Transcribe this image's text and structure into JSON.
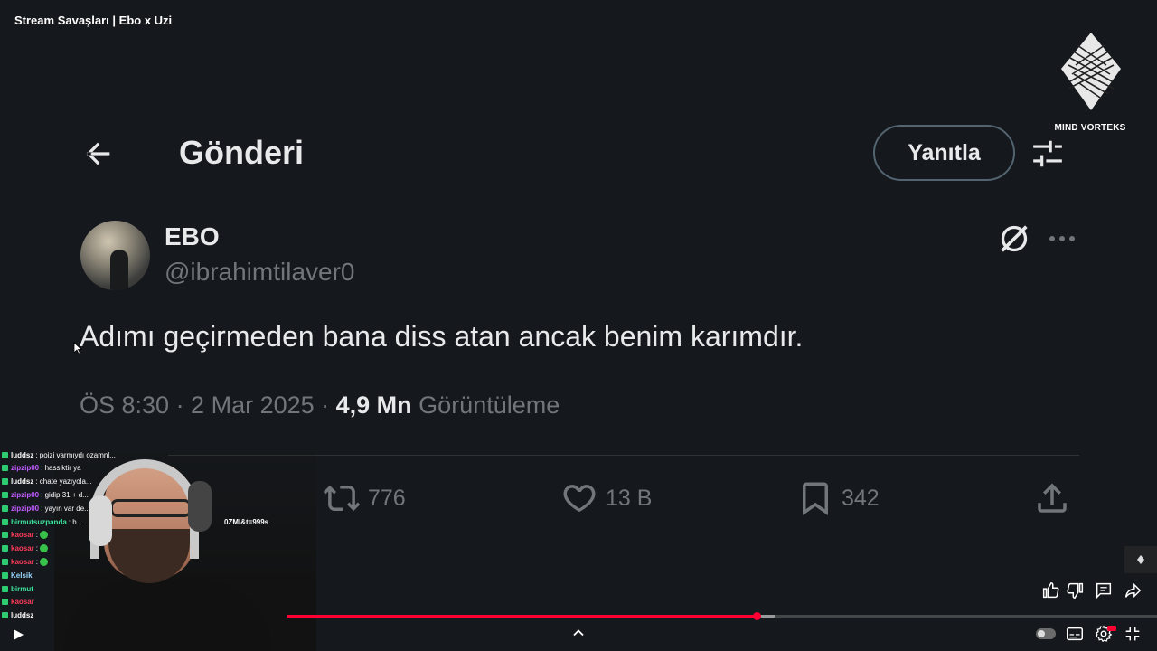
{
  "video": {
    "title": "Stream Savaşları | Ebo x Uzi",
    "channel_logo_text": "MIND VORTEKS",
    "progress_fraction": 0.54,
    "buffer_fraction": 0.56
  },
  "post_header": {
    "title": "Gönderi",
    "reply_label": "Yanıtla"
  },
  "post": {
    "author_name": "EBO",
    "author_handle": "@ibrahimtilaver0",
    "text": "Adımı geçirmeden bana diss atan ancak benim karımdır.",
    "time_date": "ÖS 8:30 · 2 Mar 2025 · ",
    "views_count": "4,9 Mn",
    "views_label": " Görüntüleme"
  },
  "actions": {
    "retweets": "776",
    "likes": "13 B",
    "bookmarks": "342"
  },
  "chat": [
    {
      "user": "luddsz",
      "msg": ": poizi varmıydı ozamnl...",
      "color": "#ffffff",
      "emote": false
    },
    {
      "user": "zipzip00",
      "msg": ": hassiktir ya",
      "color": "#c15cff",
      "emote": false
    },
    {
      "user": "luddsz",
      "msg": ": chate yazıyola...",
      "color": "#ffffff",
      "emote": false
    },
    {
      "user": "zipzip00",
      "msg": ": gidip 31 + d...",
      "color": "#c15cff",
      "emote": false
    },
    {
      "user": "zipzip00",
      "msg": ": yayın var de...",
      "color": "#c15cff",
      "emote": false
    },
    {
      "user": "birmutsuzpanda",
      "msg": ": h...",
      "color": "#3ee6a0",
      "emote": false
    },
    {
      "user": "kaosar",
      "msg": ":",
      "color": "#ff3b5c",
      "emote": true
    },
    {
      "user": "kaosar",
      "msg": ":",
      "color": "#ff3b5c",
      "emote": true
    },
    {
      "user": "kaosar",
      "msg": ":",
      "color": "#ff3b5c",
      "emote": true
    },
    {
      "user": "Kelsik",
      "msg": "",
      "color": "#9ad7ff",
      "emote": false
    },
    {
      "user": "birmut",
      "msg": "",
      "color": "#3ee6a0",
      "emote": false
    },
    {
      "user": "kaosar",
      "msg": "",
      "color": "#ff3b5c",
      "emote": false
    },
    {
      "user": "luddsz",
      "msg": "",
      "color": "#ffffff",
      "emote": false
    }
  ],
  "chat_fragment": "0ZMI&t=999s",
  "icons": {
    "back": "arrow-left-icon",
    "filter": "sliders-icon",
    "grok": "grok-icon",
    "more": "more-dots-icon",
    "reply": "reply-icon",
    "retweet": "retweet-icon",
    "like": "heart-icon",
    "bookmark": "bookmark-icon",
    "share": "share-icon"
  }
}
